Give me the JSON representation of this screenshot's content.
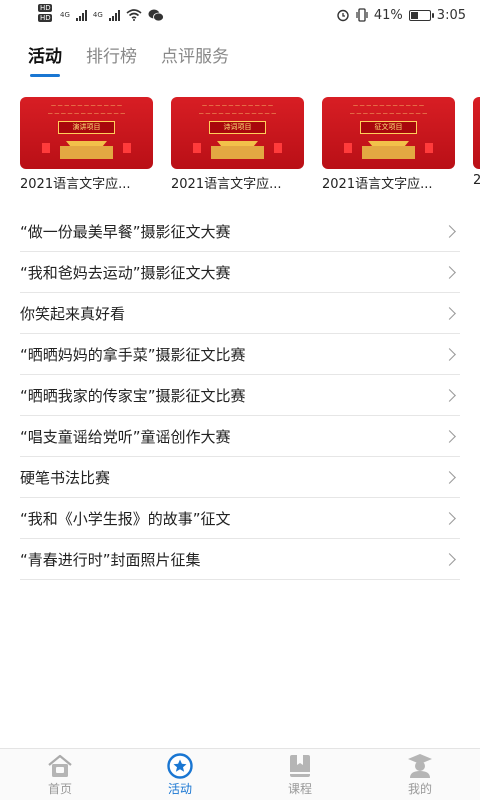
{
  "status_bar": {
    "hd1": "HD",
    "hd2": "HD",
    "net1": "4G",
    "net2": "4G",
    "battery_percent": "41%",
    "time": "3:05",
    "battery_level": 0.41
  },
  "tabs": [
    {
      "label": "活动",
      "active": true
    },
    {
      "label": "排行榜",
      "active": false
    },
    {
      "label": "点评服务",
      "active": false
    }
  ],
  "cards": [
    {
      "project": "演讲项目",
      "title": "2021语言文字应..."
    },
    {
      "project": "诗词项目",
      "title": "2021语言文字应..."
    },
    {
      "project": "征文项目",
      "title": "2021语言文字应..."
    },
    {
      "project": "",
      "title": "2"
    }
  ],
  "list": [
    {
      "label": "“做一份最美早餐”摄影征文大赛"
    },
    {
      "label": "“我和爸妈去运动”摄影征文大赛"
    },
    {
      "label": "你笑起来真好看"
    },
    {
      "label": "“晒晒妈妈的拿手菜”摄影征文比赛"
    },
    {
      "label": "“晒晒我家的传家宝”摄影征文比赛"
    },
    {
      "label": "“唱支童谣给党听”童谣创作大赛"
    },
    {
      "label": "硬笔书法比赛"
    },
    {
      "label": "“我和《小学生报》的故事”征文"
    },
    {
      "label": "“青春进行时”封面照片征集"
    }
  ],
  "bottom_nav": [
    {
      "label": "首页",
      "icon": "home-icon",
      "active": false
    },
    {
      "label": "活动",
      "icon": "star-circle-icon",
      "active": true
    },
    {
      "label": "课程",
      "icon": "book-icon",
      "active": false
    },
    {
      "label": "我的",
      "icon": "graduate-icon",
      "active": false
    }
  ],
  "colors": {
    "accent": "#1976d2",
    "card_red": "#d81e24",
    "inactive": "#999999"
  }
}
